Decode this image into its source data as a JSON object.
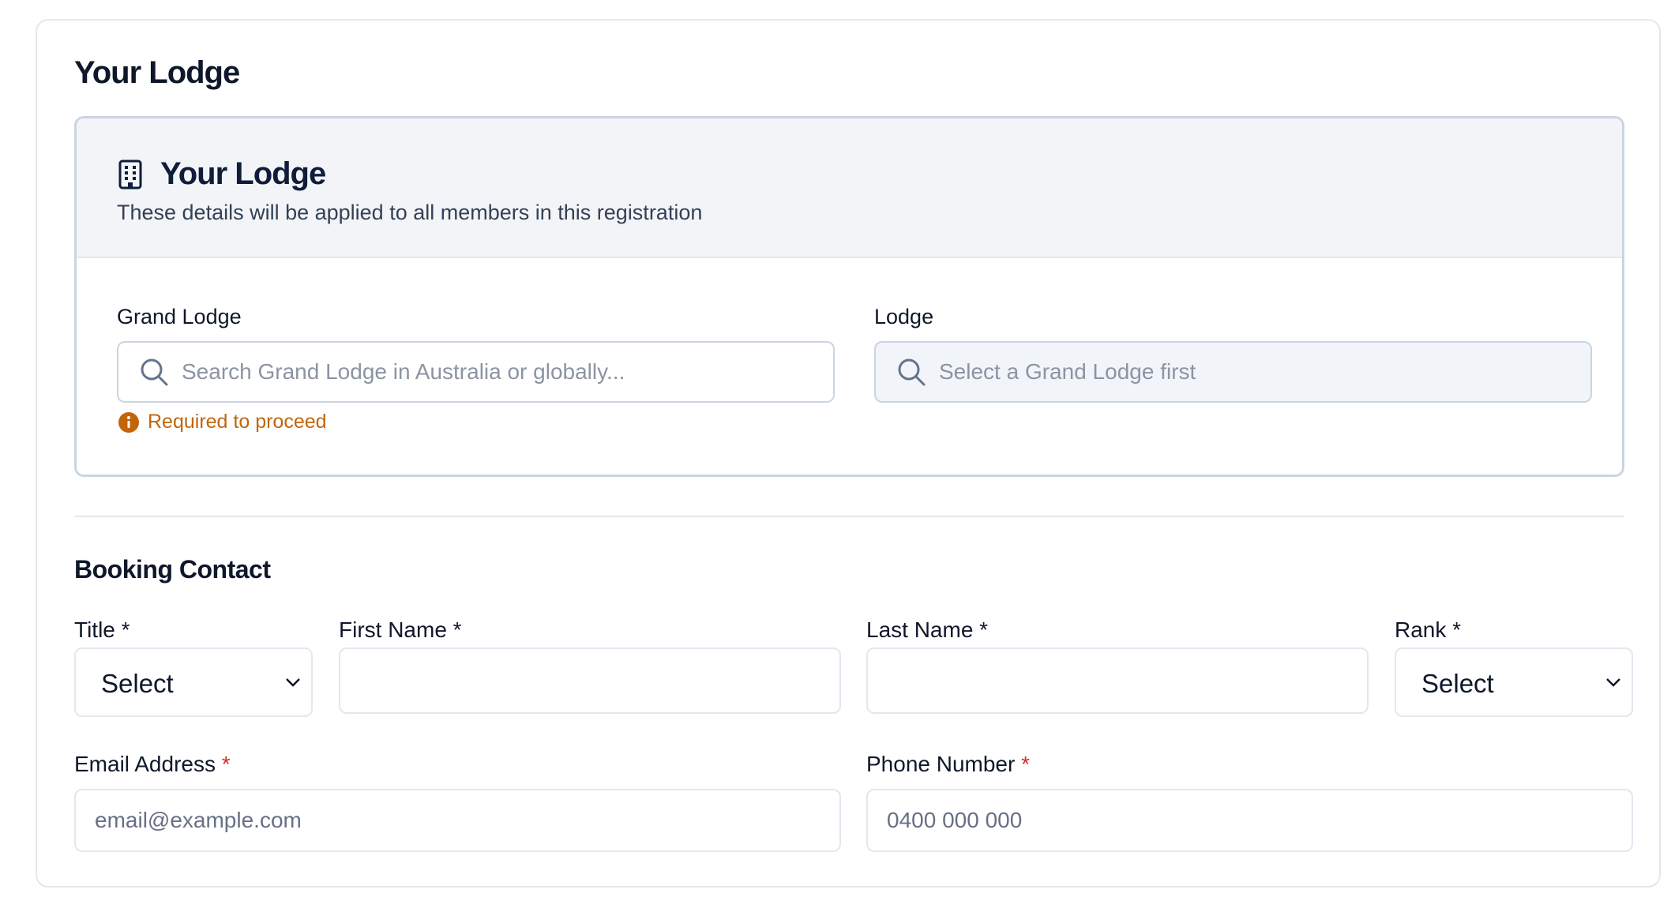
{
  "page": {
    "title": "Your Lodge"
  },
  "lodge_panel": {
    "heading": "Your Lodge",
    "subtitle": "These details will be applied to all members in this registration",
    "icon": "building-icon",
    "grand_lodge": {
      "label": "Grand Lodge",
      "placeholder": "Search Grand Lodge in Australia or globally...",
      "value": "",
      "validation": "Required to proceed"
    },
    "lodge": {
      "label": "Lodge",
      "placeholder": "Select a Grand Lodge first",
      "value": "",
      "disabled": true
    }
  },
  "booking_contact": {
    "title": "Booking Contact",
    "title_field": {
      "label": "Title *",
      "value": "Select"
    },
    "first_name": {
      "label": "First Name *",
      "value": ""
    },
    "last_name": {
      "label": "Last Name *",
      "value": ""
    },
    "rank": {
      "label": "Rank *",
      "value": "Select"
    },
    "email": {
      "label": "Email Address",
      "required_marker": "*",
      "placeholder": "email@example.com",
      "value": ""
    },
    "phone": {
      "label": "Phone Number",
      "required_marker": "*",
      "placeholder": "0400 000 000",
      "value": ""
    }
  },
  "colors": {
    "warning": "#c2650a",
    "required": "#dc2626",
    "header_bg": "#f2f4f7"
  }
}
